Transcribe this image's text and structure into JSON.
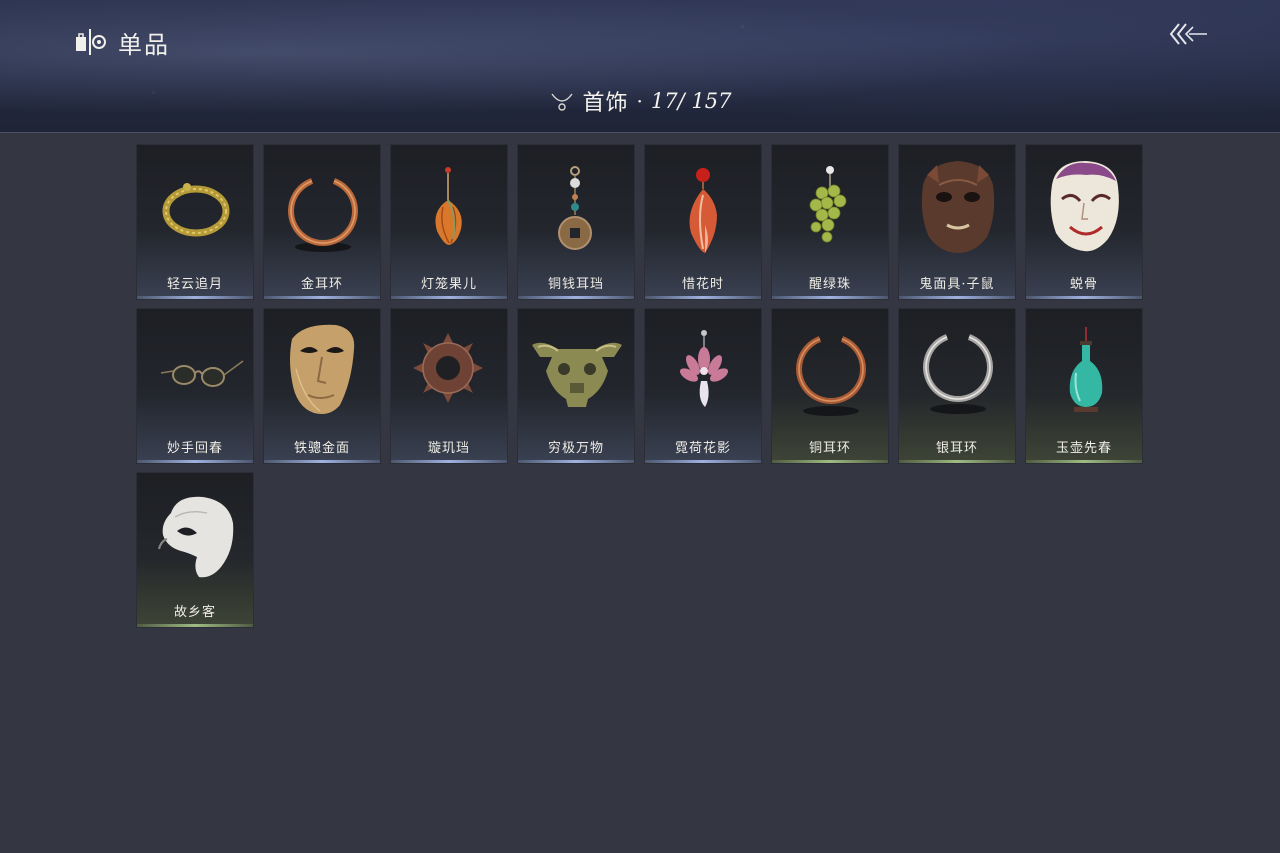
{
  "header": {
    "title": "单品",
    "back_icon": "back-arrow-icon",
    "category": {
      "icon": "necklace-icon",
      "name": "首饰",
      "separator": "·",
      "count": "17/ 157"
    }
  },
  "items": [
    {
      "name": "轻云追月",
      "icon": "gold-bracelet-icon"
    },
    {
      "name": "金耳环",
      "icon": "copper-ring-icon"
    },
    {
      "name": "灯笼果儿",
      "icon": "lantern-fruit-earring-icon"
    },
    {
      "name": "铜钱耳珰",
      "icon": "coin-earring-icon"
    },
    {
      "name": "惜花时",
      "icon": "petal-earring-icon"
    },
    {
      "name": "醒绿珠",
      "icon": "grape-earring-icon"
    },
    {
      "name": "鬼面具·子鼠",
      "icon": "rat-mask-icon"
    },
    {
      "name": "蜕骨",
      "icon": "opera-mask-icon"
    },
    {
      "name": "妙手回春",
      "icon": "round-glasses-icon"
    },
    {
      "name": "铁骢金面",
      "icon": "gold-half-mask-icon"
    },
    {
      "name": "璇玑珰",
      "icon": "gear-ring-icon"
    },
    {
      "name": "穷极万物",
      "icon": "bronze-mask-icon"
    },
    {
      "name": "霓荷花影",
      "icon": "lotus-earring-icon"
    },
    {
      "name": "铜耳环",
      "icon": "copper-ring-icon"
    },
    {
      "name": "银耳环",
      "icon": "silver-ring-icon"
    },
    {
      "name": "玉壶先春",
      "icon": "jade-vase-icon"
    },
    {
      "name": "故乡客",
      "icon": "white-mask-icon"
    }
  ],
  "colors": {
    "background": "#343741",
    "card_blue_accent": "#aabef0",
    "card_green_accent": "#aac88c"
  }
}
